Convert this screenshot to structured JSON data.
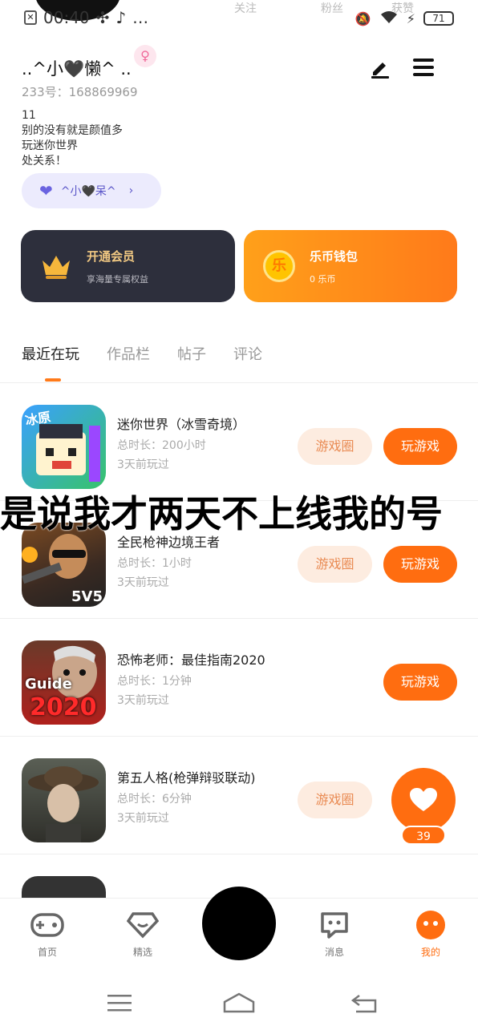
{
  "status_bar": {
    "time": "00:40",
    "battery": "71"
  },
  "top_tabs": [
    "关注",
    "粉丝",
    "获赞"
  ],
  "profile": {
    "nickname": "..^小🖤懒^ ..",
    "uid": "233号：168869969",
    "bio": [
      "11",
      "别的没有就是颜值多",
      "玩迷你世界",
      "处关系！"
    ],
    "fan_pill_label": "^小🖤呆^"
  },
  "cards": {
    "vip": {
      "title": "开通会员",
      "subtitle": "享海量专属权益"
    },
    "wallet": {
      "title": "乐币钱包",
      "subtitle": "0 乐币",
      "coin_text": "乐"
    }
  },
  "content_tabs": [
    "最近在玩",
    "作品栏",
    "帖子",
    "评论"
  ],
  "games": [
    {
      "name": "迷你世界（冰雪奇境）",
      "time": "总时长：200小时",
      "last": "3天前玩过",
      "circle_btn": "游戏圈",
      "play_btn": "玩游戏"
    },
    {
      "name": "全民枪神边境王者",
      "time": "总时长：1小时",
      "last": "3天前玩过",
      "circle_btn": "游戏圈",
      "play_btn": "玩游戏"
    },
    {
      "name": "恐怖老师：最佳指南2020",
      "time": "总时长：1分钟",
      "last": "3天前玩过",
      "circle_btn": "",
      "play_btn": "玩游戏"
    },
    {
      "name": "第五人格(枪弹辩驳联动)",
      "time": "总时长：6分钟",
      "last": "3天前玩过",
      "circle_btn": "游戏圈",
      "play_btn": ""
    }
  ],
  "game_icon_labels": {
    "mini": "冰原",
    "teacher_top": "Guide",
    "teacher_bottom": "2020",
    "gun": "5V5"
  },
  "subtitle_overlay": "是说我才两天不上线我的号",
  "float_like_count": "39",
  "bottom_nav": [
    "首页",
    "精选",
    "消息",
    "我的"
  ],
  "colors": {
    "accent": "#ff6d10",
    "vip_bg": "#2d2f3c"
  }
}
